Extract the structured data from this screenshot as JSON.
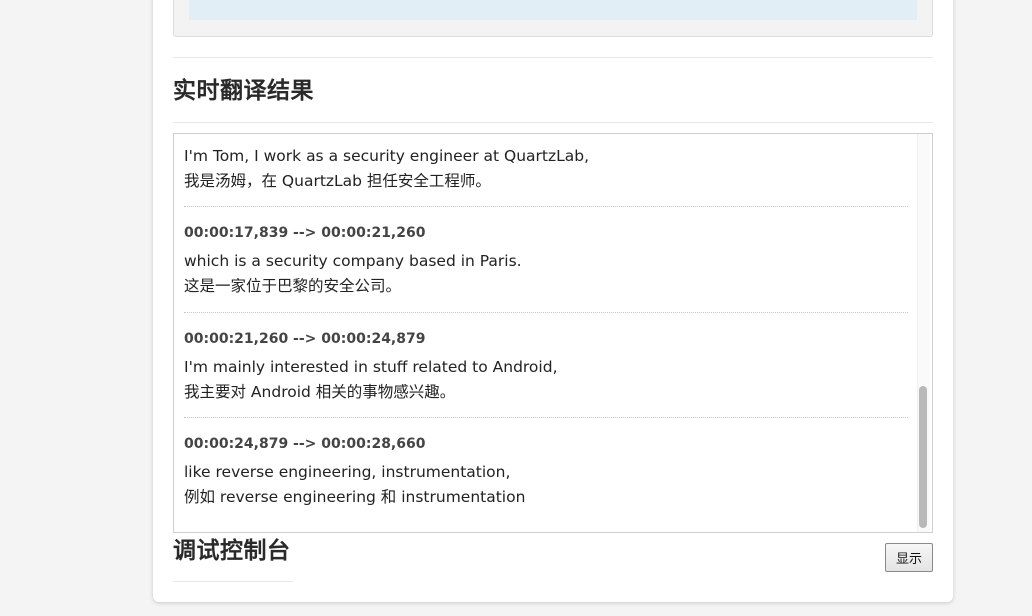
{
  "sections": {
    "results_title": "实时翻译结果",
    "console_title": "调试控制台"
  },
  "results": {
    "partial_line": "..., ... ... ... ... ...",
    "entries": [
      {
        "source": "I'm Tom, I work as a security engineer at QuartzLab,",
        "translation": "我是汤姆，在 QuartzLab 担任安全工程师。"
      },
      {
        "timestamp": "00:00:17,839 --> 00:00:21,260",
        "source": "which is a security company based in Paris.",
        "translation": "这是一家位于巴黎的安全公司。"
      },
      {
        "timestamp": "00:00:21,260 --> 00:00:24,879",
        "source": "I'm mainly interested in stuff related to Android,",
        "translation": "我主要对 Android 相关的事物感兴趣。"
      },
      {
        "timestamp": "00:00:24,879 --> 00:00:28,660",
        "source": "like reverse engineering, instrumentation,",
        "translation": "例如 reverse engineering 和 instrumentation"
      }
    ]
  },
  "console": {
    "toggle_label": "显示"
  }
}
